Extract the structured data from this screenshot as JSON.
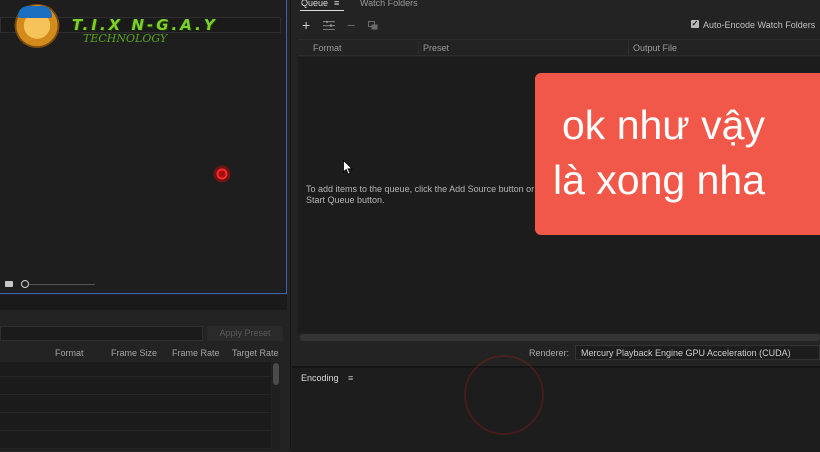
{
  "logo": {
    "title": "T.I.X N-G.A.Y",
    "subtitle": "TECHNOLOGY"
  },
  "queue_panel": {
    "tabs": [
      {
        "label": "Queue",
        "menu_icon": "≡"
      },
      {
        "label": "Watch Folders"
      }
    ],
    "toolbar": {
      "add_source": "+",
      "remove": "−",
      "auto_encode_checked": true,
      "auto_encode_label": "Auto-Encode Watch Folders"
    },
    "columns": [
      "Format",
      "Preset",
      "Output File"
    ],
    "help_text": "To add items to the queue, click the Add Source button or drag files here. Click the Start Queue button.",
    "help_text_visible_line_1": "To add items to the queue, click the Add Source button or",
    "help_text_visible_line_2": "Start Queue button.",
    "renderer_label": "Renderer:",
    "renderer_value": "Mercury Playback Engine GPU Acceleration (CUDA)"
  },
  "encoding_panel": {
    "tab_label": "Encoding",
    "menu_icon": "≡"
  },
  "preset_panel": {
    "apply_preset_label": "Apply Preset",
    "columns": [
      "Format",
      "Frame Size",
      "Frame Rate",
      "Target Rate"
    ]
  },
  "caption": {
    "line_1": "ok như vậy",
    "line_2": "là xong nha",
    "color": "#f2584a"
  },
  "colors": {
    "panel_focus_border": "#3a63b5",
    "background": "#232323"
  }
}
